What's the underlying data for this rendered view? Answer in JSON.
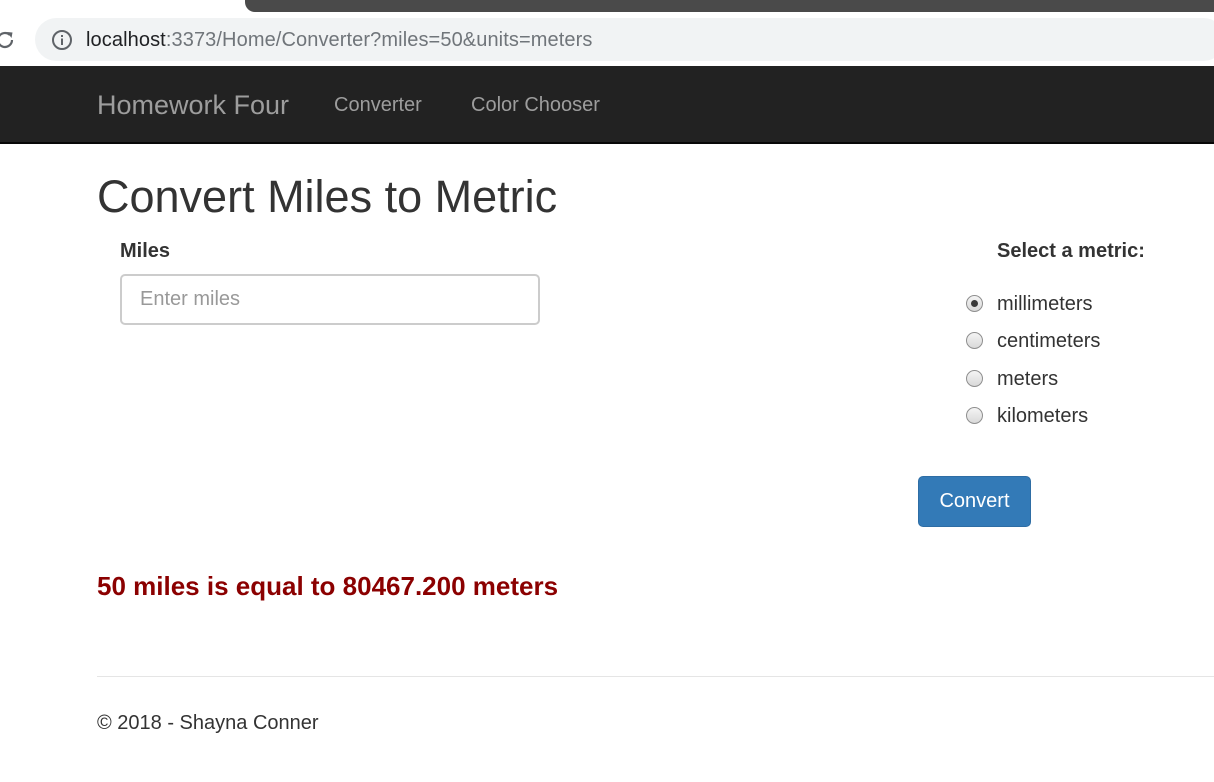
{
  "browser": {
    "url_host": "localhost",
    "url_rest": ":3373/Home/Converter?miles=50&units=meters",
    "icons": {
      "reload": "reload-icon",
      "info": "info-icon"
    }
  },
  "navbar": {
    "brand": "Homework Four",
    "links": [
      "Converter",
      "Color Chooser"
    ]
  },
  "page": {
    "title": "Convert Miles to Metric"
  },
  "form": {
    "miles_label": "Miles",
    "miles_placeholder": "Enter miles",
    "miles_value": "",
    "metric_label": "Select a metric:",
    "metrics": [
      {
        "label": "millimeters",
        "checked": true
      },
      {
        "label": "centimeters",
        "checked": false
      },
      {
        "label": "meters",
        "checked": false
      },
      {
        "label": "kilometers",
        "checked": false
      }
    ],
    "convert_label": "Convert"
  },
  "result": {
    "text": "50 miles is equal to 80467.200 meters",
    "color": "#8b0000"
  },
  "footer": {
    "text": "© 2018 - Shayna Conner"
  },
  "colors": {
    "navbar_bg": "#222222",
    "button_primary": "#337ab7"
  }
}
